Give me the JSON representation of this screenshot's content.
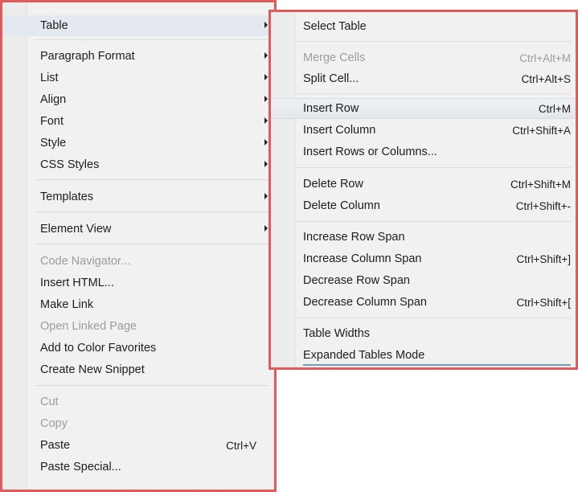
{
  "main_menu": {
    "items": [
      {
        "label": "Table",
        "submenu": true
      },
      {
        "label": "Paragraph Format",
        "submenu": true
      },
      {
        "label": "List",
        "submenu": true
      },
      {
        "label": "Align",
        "submenu": true
      },
      {
        "label": "Font",
        "submenu": true
      },
      {
        "label": "Style",
        "submenu": true
      },
      {
        "label": "CSS Styles",
        "submenu": true
      },
      {
        "label": "Templates",
        "submenu": true
      },
      {
        "label": "Element View",
        "submenu": true
      },
      {
        "label": "Code Navigator...",
        "disabled": true
      },
      {
        "label": "Insert HTML..."
      },
      {
        "label": "Make Link"
      },
      {
        "label": "Open Linked Page",
        "disabled": true
      },
      {
        "label": "Add to Color Favorites"
      },
      {
        "label": "Create New Snippet"
      },
      {
        "label": "Cut",
        "disabled": true
      },
      {
        "label": "Copy",
        "disabled": true
      },
      {
        "label": "Paste",
        "shortcut": "Ctrl+V"
      },
      {
        "label": "Paste Special..."
      }
    ]
  },
  "table_submenu": {
    "items": [
      {
        "label": "Select Table"
      },
      {
        "label": "Merge Cells",
        "shortcut": "Ctrl+Alt+M",
        "disabled": true
      },
      {
        "label": "Split Cell...",
        "shortcut": "Ctrl+Alt+S"
      },
      {
        "label": "Insert Row",
        "shortcut": "Ctrl+M"
      },
      {
        "label": "Insert Column",
        "shortcut": "Ctrl+Shift+A"
      },
      {
        "label": "Insert Rows or Columns..."
      },
      {
        "label": "Delete Row",
        "shortcut": "Ctrl+Shift+M"
      },
      {
        "label": "Delete Column",
        "shortcut": "Ctrl+Shift+-"
      },
      {
        "label": "Increase Row Span"
      },
      {
        "label": "Increase Column Span",
        "shortcut": "Ctrl+Shift+]"
      },
      {
        "label": "Decrease Row Span"
      },
      {
        "label": "Decrease Column Span",
        "shortcut": "Ctrl+Shift+["
      },
      {
        "label": "Table Widths"
      },
      {
        "label": "Expanded Tables Mode"
      }
    ]
  },
  "colors": {
    "frame_highlight": "#e05a5a",
    "menu_background": "#f1f1f1",
    "disabled_text": "#9c9c9c",
    "hover_background": "#e4e8ef"
  }
}
